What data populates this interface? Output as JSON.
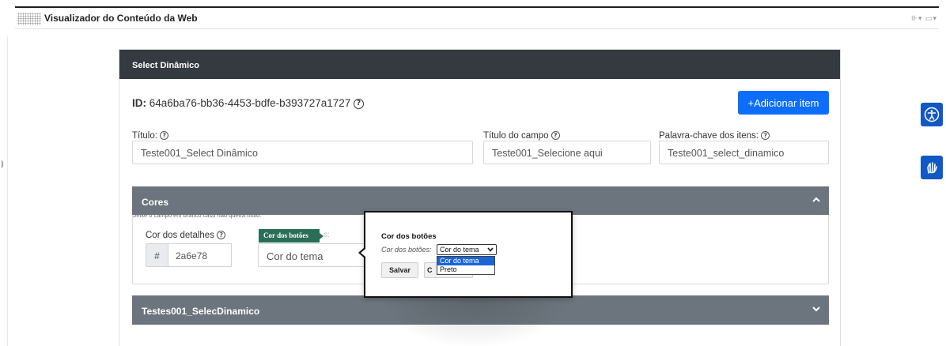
{
  "app": {
    "title": "Visualizador do Conteúdo da Web",
    "header_icons": "⊪▾ ▭▾",
    "side_mark": "⦘"
  },
  "card": {
    "title": "Select Dinâmico",
    "id_label": "ID:",
    "id_value": "64a6ba76-bb36-4453-bdfe-b393727a1727",
    "add_button": "+Adicionar item",
    "fields": {
      "titulo_label": "Título:",
      "titulo_value": "Teste001_Select Dinâmico",
      "titulo_hint": "Deixe o campo em branco caso não queira título.",
      "campo_label": "Título do campo",
      "campo_value": "Teste001_Selecione aqui",
      "palavra_label": "Palavra-chave dos itens:",
      "palavra_value": "Teste001_select_dinamico"
    }
  },
  "accordions": {
    "cores": {
      "title": "Cores",
      "detalhes_label": "Cor dos detalhes",
      "hash": "#",
      "detalhes_value": "2a6e78",
      "botoes_tooltip": "Cor dos botões",
      "botoes_value": "Cor do tema",
      "tooltip_spill": "s:"
    },
    "testes": {
      "title": "Testes001_SelecDinamico"
    }
  },
  "popup": {
    "title": "Cor dos botões",
    "label": "Cor dos botões:",
    "selected": "Cor do tema",
    "options": [
      "Cor do tema",
      "Preto"
    ],
    "save": "Salvar",
    "cancel_partial": "C"
  },
  "colors": {
    "card_header": "#343a40",
    "accordion": "#6c757d",
    "primary": "#0d6efd",
    "tooltip": "#2a6e58",
    "fab": "#1258c4"
  },
  "icons": {
    "help": "question-circle-icon",
    "accessibility": "accessibility-icon",
    "sign_language": "sign-language-icon"
  }
}
